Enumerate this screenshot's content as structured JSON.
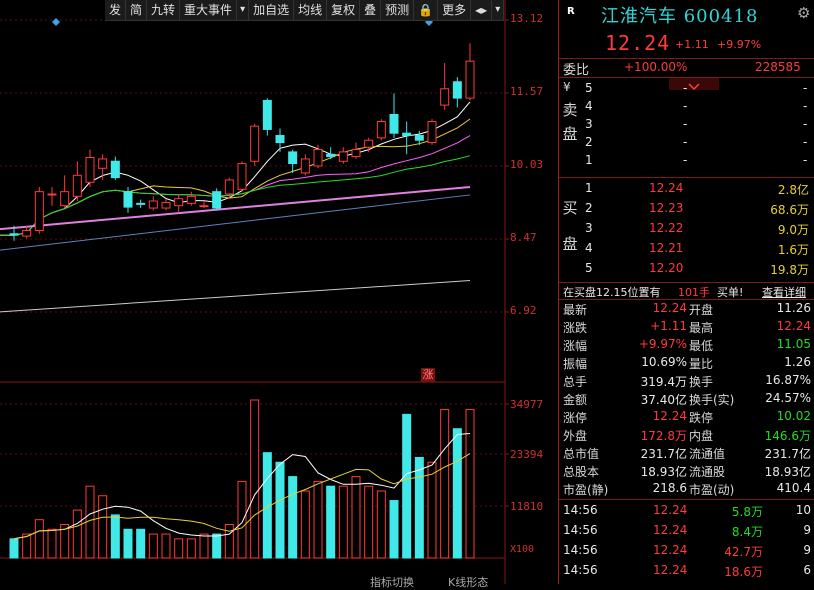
{
  "toolbar": {
    "items": [
      "发",
      "简",
      "九转",
      "重大事件",
      "▾",
      "加自选",
      "均线",
      "复权",
      "叠",
      "预测",
      "🔒",
      "更多",
      "◂▸",
      "▾"
    ]
  },
  "price_axis": [
    "13.12",
    "11.57",
    "10.03",
    "8.47",
    "6.92"
  ],
  "volume_axis": [
    "34977",
    "23394",
    "11810",
    "X100"
  ],
  "zhang_mark": "涨",
  "stock": {
    "tag": "R",
    "name": "江淮汽车 600418",
    "price": "12.24",
    "change": "+1.11",
    "pct": "+9.97%"
  },
  "weibi": {
    "label": "委比",
    "pct": "+100.00%",
    "value": "228585"
  },
  "sell": {
    "side_chars": [
      "卖",
      "盘"
    ],
    "currency": "¥",
    "rows": [
      {
        "level": "5",
        "price": "-",
        "vol": "-"
      },
      {
        "level": "4",
        "price": "-",
        "vol": "-"
      },
      {
        "level": "3",
        "price": "-",
        "vol": "-"
      },
      {
        "level": "2",
        "price": "-",
        "vol": "-"
      },
      {
        "level": "1",
        "price": "-",
        "vol": "-"
      }
    ]
  },
  "buy": {
    "side_chars": [
      "买",
      "盘"
    ],
    "rows": [
      {
        "level": "1",
        "price": "12.24",
        "vol": "2.8亿"
      },
      {
        "level": "2",
        "price": "12.23",
        "vol": "68.6万"
      },
      {
        "level": "3",
        "price": "12.22",
        "vol": "9.0万"
      },
      {
        "level": "4",
        "price": "12.21",
        "vol": "1.6万"
      },
      {
        "level": "5",
        "price": "12.20",
        "vol": "19.8万"
      }
    ]
  },
  "info_line": {
    "text": "在买盘12.15位置有",
    "num": "101手",
    "buy": "买单!",
    "detail": "查看详细"
  },
  "stats": [
    {
      "l1": "最新",
      "v1": "12.24",
      "l2": "开盘",
      "v2": "11.26"
    },
    {
      "l1": "涨跌",
      "v1": "+1.11",
      "l2": "最高",
      "v2": "12.24"
    },
    {
      "l1": "涨幅",
      "v1": "+9.97%",
      "l2": "最低",
      "v2": "11.05"
    },
    {
      "l1": "振幅",
      "v1": "10.69%",
      "l2": "量比",
      "v2": "1.26"
    },
    {
      "l1": "总手",
      "v1": "319.4万",
      "l2": "换手",
      "v2": "16.87%"
    },
    {
      "l1": "金额",
      "v1": "37.40亿",
      "l2": "换手(实)",
      "v2": "24.57%"
    },
    {
      "l1": "涨停",
      "v1": "12.24",
      "l2": "跌停",
      "v2": "10.02"
    },
    {
      "l1": "外盘",
      "v1": "172.8万",
      "l2": "内盘",
      "v2": "146.6万"
    },
    {
      "l1": "总市值",
      "v1": "231.7亿",
      "l2": "流通值",
      "v2": "231.7亿"
    },
    {
      "l1": "总股本",
      "v1": "18.93亿",
      "l2": "流通股",
      "v2": "18.93亿"
    },
    {
      "l1": "市盈(静)",
      "v1": "218.6",
      "l2": "市盈(动)",
      "v2": "410.4"
    }
  ],
  "ticks": [
    {
      "time": "14:56",
      "price": "12.24",
      "vol": "5.8万",
      "n": "10"
    },
    {
      "time": "14:56",
      "price": "12.24",
      "vol": "8.4万",
      "n": "9"
    },
    {
      "time": "14:56",
      "price": "12.24",
      "vol": "42.7万",
      "n": "9"
    },
    {
      "time": "14:56",
      "price": "12.24",
      "vol": "18.6万",
      "n": "6"
    }
  ],
  "bottom_tabs": [
    "指标切换",
    "K线形态"
  ],
  "chart_data": {
    "type": "candlestick",
    "candles": [
      {
        "o": 8.55,
        "c": 8.52,
        "h": 8.72,
        "l": 8.4
      },
      {
        "o": 8.5,
        "c": 8.62,
        "h": 8.72,
        "l": 8.45
      },
      {
        "o": 8.62,
        "c": 9.45,
        "h": 9.55,
        "l": 8.55
      },
      {
        "o": 9.38,
        "c": 9.4,
        "h": 9.55,
        "l": 9.15
      },
      {
        "o": 9.15,
        "c": 9.45,
        "h": 9.8,
        "l": 9.1
      },
      {
        "o": 9.35,
        "c": 9.8,
        "h": 10.1,
        "l": 9.25
      },
      {
        "o": 9.65,
        "c": 10.18,
        "h": 10.35,
        "l": 9.55
      },
      {
        "o": 9.95,
        "c": 10.15,
        "h": 10.25,
        "l": 9.7
      },
      {
        "o": 10.1,
        "c": 9.75,
        "h": 10.2,
        "l": 9.7
      },
      {
        "o": 9.45,
        "c": 9.12,
        "h": 9.55,
        "l": 9.0
      },
      {
        "o": 9.2,
        "c": 9.18,
        "h": 9.28,
        "l": 9.1
      },
      {
        "o": 9.1,
        "c": 9.25,
        "h": 9.35,
        "l": 9.05
      },
      {
        "o": 9.1,
        "c": 9.22,
        "h": 9.3,
        "l": 9.05
      },
      {
        "o": 9.15,
        "c": 9.3,
        "h": 9.4,
        "l": 9.0
      },
      {
        "o": 9.2,
        "c": 9.35,
        "h": 9.45,
        "l": 9.15
      },
      {
        "o": 9.15,
        "c": 9.15,
        "h": 9.25,
        "l": 9.1
      },
      {
        "o": 9.45,
        "c": 9.1,
        "h": 9.52,
        "l": 9.05
      },
      {
        "o": 9.4,
        "c": 9.7,
        "h": 9.75,
        "l": 9.3
      },
      {
        "o": 9.5,
        "c": 10.05,
        "h": 10.1,
        "l": 9.45
      },
      {
        "o": 10.1,
        "c": 10.85,
        "h": 10.9,
        "l": 10.0
      },
      {
        "o": 11.4,
        "c": 10.78,
        "h": 11.45,
        "l": 10.65
      },
      {
        "o": 10.65,
        "c": 10.5,
        "h": 10.8,
        "l": 10.3
      },
      {
        "o": 10.3,
        "c": 10.05,
        "h": 10.35,
        "l": 9.85
      },
      {
        "o": 9.85,
        "c": 10.15,
        "h": 10.25,
        "l": 9.8
      },
      {
        "o": 10.0,
        "c": 10.35,
        "h": 10.45,
        "l": 9.95
      },
      {
        "o": 10.25,
        "c": 10.2,
        "h": 10.4,
        "l": 10.15
      },
      {
        "o": 10.1,
        "c": 10.3,
        "h": 10.4,
        "l": 10.05
      },
      {
        "o": 10.2,
        "c": 10.35,
        "h": 10.5,
        "l": 10.15
      },
      {
        "o": 10.4,
        "c": 10.55,
        "h": 10.6,
        "l": 10.3
      },
      {
        "o": 10.6,
        "c": 10.95,
        "h": 11.0,
        "l": 10.55
      },
      {
        "o": 11.1,
        "c": 10.7,
        "h": 11.55,
        "l": 10.6
      },
      {
        "o": 10.7,
        "c": 10.65,
        "h": 10.95,
        "l": 10.25
      },
      {
        "o": 10.65,
        "c": 10.55,
        "h": 10.75,
        "l": 10.45
      },
      {
        "o": 10.5,
        "c": 10.95,
        "h": 11.0,
        "l": 10.45
      },
      {
        "o": 11.3,
        "c": 11.65,
        "h": 12.2,
        "l": 11.2
      },
      {
        "o": 11.8,
        "c": 11.45,
        "h": 11.9,
        "l": 11.25
      },
      {
        "o": 11.45,
        "c": 12.24,
        "h": 12.62,
        "l": 11.4
      }
    ],
    "volumes": [
      4,
      5,
      8,
      6,
      7,
      10,
      15,
      13,
      9,
      6,
      6,
      5,
      5,
      4,
      4,
      5,
      5,
      7,
      16,
      33,
      22,
      20,
      17,
      14,
      16,
      15,
      15,
      17,
      15,
      14,
      12,
      30,
      21,
      20,
      31,
      27,
      31
    ],
    "ylim": [
      6.92,
      13.12
    ],
    "vol_ylim": [
      0,
      34977
    ]
  },
  "colors": {
    "up": "#ff3a3a",
    "down": "#40e8e8",
    "ma1": "#ffffff",
    "ma2": "#e6d030",
    "ma3": "#ff60ff",
    "ma4": "#22dd22"
  }
}
